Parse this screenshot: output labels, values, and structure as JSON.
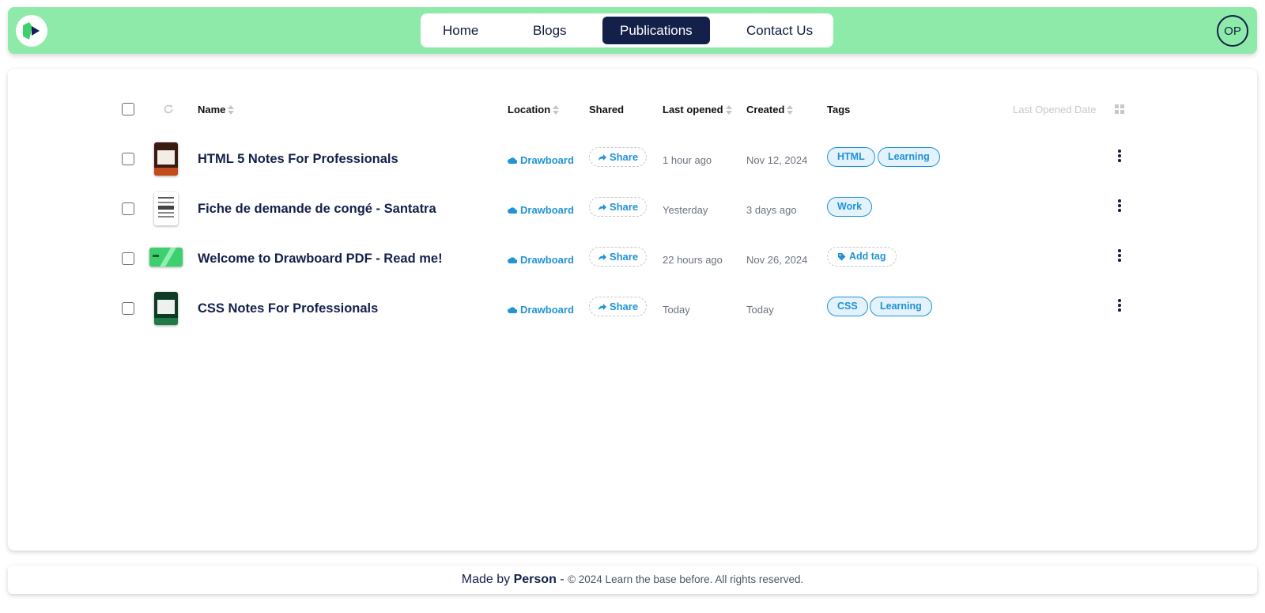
{
  "nav": {
    "items": [
      {
        "label": "Home",
        "active": false
      },
      {
        "label": "Blogs",
        "active": false
      },
      {
        "label": "Publications",
        "active": true
      },
      {
        "label": "Contact Us",
        "active": false
      }
    ],
    "avatar": "OP"
  },
  "table": {
    "headers": {
      "name": "Name",
      "location": "Location",
      "shared": "Shared",
      "last_opened": "Last opened",
      "created": "Created",
      "tags": "Tags",
      "sort_label": "Last Opened Date"
    },
    "rows": [
      {
        "name": "HTML 5 Notes For Professionals",
        "location": "Drawboard",
        "share": "Share",
        "last_opened": "1 hour ago",
        "created": "Nov 12, 2024",
        "tags": [
          "HTML",
          "Learning"
        ],
        "thumb_color": "#3b1a12"
      },
      {
        "name": "Fiche de demande de congé - Santatra",
        "location": "Drawboard",
        "share": "Share",
        "last_opened": "Yesterday",
        "created": "3 days ago",
        "tags": [
          "Work"
        ],
        "thumb_color": "#ffffff"
      },
      {
        "name": "Welcome to Drawboard PDF - Read me!",
        "location": "Drawboard",
        "share": "Share",
        "last_opened": "22 hours ago",
        "created": "Nov 26, 2024",
        "tags": [],
        "add_tag": "Add tag",
        "thumb_color": "#3ecf6f"
      },
      {
        "name": "CSS Notes For Professionals",
        "location": "Drawboard",
        "share": "Share",
        "last_opened": "Today",
        "created": "Today",
        "tags": [
          "CSS",
          "Learning"
        ],
        "thumb_color": "#0f3a24"
      }
    ]
  },
  "footer": {
    "made_by": "Made by",
    "author": "Person",
    "dash": "-",
    "copyright": "© 2024 Learn the base before. All rights reserved."
  },
  "colors": {
    "header_bg": "#8eeaa9",
    "nav_active": "#13214a",
    "accent": "#2193d6"
  }
}
